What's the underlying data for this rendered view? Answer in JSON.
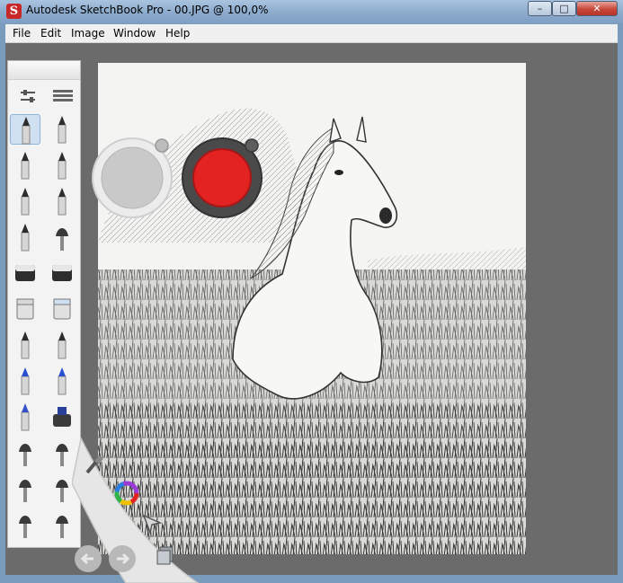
{
  "window": {
    "title": "Autodesk SketchBook Pro - 00.JPG @ 100,0%",
    "app_icon_glyph": "S",
    "controls": {
      "minimize": "–",
      "maximize": "□",
      "close": "✕"
    }
  },
  "menu": {
    "items": [
      "File",
      "Edit",
      "Image",
      "Window",
      "Help"
    ]
  },
  "toolbar": {
    "header_icons": [
      "slider-settings-icon",
      "layers-list-icon"
    ],
    "tools": [
      "pencil-icon",
      "ballpoint-pen-icon",
      "marker-icon",
      "chisel-marker-icon",
      "felt-pen-icon",
      "calligraphy-pen-icon",
      "technical-pen-icon",
      "airbrush-nib-icon",
      "eraser-icon",
      "hard-eraser-icon",
      "paint-bucket-icon",
      "fill-copy-icon",
      "chalk-icon",
      "crayon-icon",
      "blue-marker-icon",
      "blue-pen-icon",
      "blue-highlighter-icon",
      "ink-bottle-icon",
      "small-brush-icon",
      "fan-brush-icon",
      "flat-brush-icon",
      "round-brush-icon",
      "smudge-icon",
      "blender-icon"
    ],
    "selected_tool": "pencil-icon"
  },
  "pucks": {
    "brush_size_color": "#c9c9c9",
    "current_color": "#e32222"
  },
  "lagoon": {
    "items": [
      "brush-palette-icon",
      "color-wheel-icon",
      "select-arrow-icon",
      "layer-icon",
      "undo-icon",
      "redo-icon"
    ]
  },
  "canvas": {
    "subject": "pencil sketch of a white horse running through tall grass"
  },
  "colors": {
    "workspace": "#6b6b6b",
    "titlebar": "#8eaccd",
    "accent_red": "#e32222"
  }
}
